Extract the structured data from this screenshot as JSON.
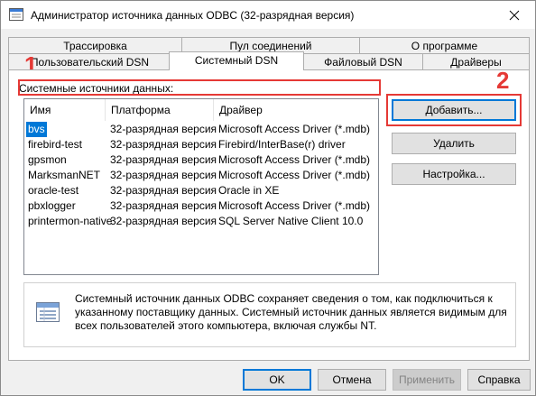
{
  "window": {
    "title": "Администратор источника данных ODBC (32-разрядная версия)",
    "close_icon": "close-icon"
  },
  "tabs_row1": [
    {
      "label": "Трассировка"
    },
    {
      "label": "Пул соединений"
    },
    {
      "label": "О программе"
    }
  ],
  "tabs_row2": [
    {
      "label": "Пользовательский DSN"
    },
    {
      "label": "Системный DSN",
      "active": true
    },
    {
      "label": "Файловый DSN"
    },
    {
      "label": "Драйверы"
    }
  ],
  "annotations": {
    "marker_1": "1",
    "marker_2": "2",
    "color": "#e53935"
  },
  "system_dsn": {
    "group_label": "Системные источники данных:",
    "columns": [
      "Имя",
      "Платформа",
      "Драйвер"
    ],
    "rows": [
      {
        "name": "bvs",
        "platform": "32-разрядная версия",
        "driver": "Microsoft Access Driver (*.mdb)",
        "selected": true
      },
      {
        "name": "firebird-test",
        "platform": "32-разрядная версия",
        "driver": "Firebird/InterBase(r) driver"
      },
      {
        "name": "gpsmon",
        "platform": "32-разрядная версия",
        "driver": "Microsoft Access Driver (*.mdb)"
      },
      {
        "name": "MarksmanNET",
        "platform": "32-разрядная версия",
        "driver": "Microsoft Access Driver (*.mdb)"
      },
      {
        "name": "oracle-test",
        "platform": "32-разрядная версия",
        "driver": "Oracle in XE"
      },
      {
        "name": "pbxlogger",
        "platform": "32-разрядная версия",
        "driver": "Microsoft Access Driver (*.mdb)"
      },
      {
        "name": "printermon-native",
        "platform": "32-разрядная версия",
        "driver": "SQL Server Native Client 10.0"
      }
    ],
    "buttons": {
      "add": "Добавить...",
      "remove": "Удалить",
      "configure": "Настройка..."
    },
    "info_icon": "data-source-icon",
    "info_text": "Системный источник данных ODBC сохраняет сведения о том, как подключиться к указанному поставщику данных.  Системный источник данных является видимым для всех пользователей этого компьютера, включая службы NT."
  },
  "footer": {
    "ok": "OK",
    "cancel": "Отмена",
    "apply": "Применить",
    "help": "Справка"
  },
  "colors": {
    "selection": "#0078d7",
    "highlight": "#e53935"
  }
}
